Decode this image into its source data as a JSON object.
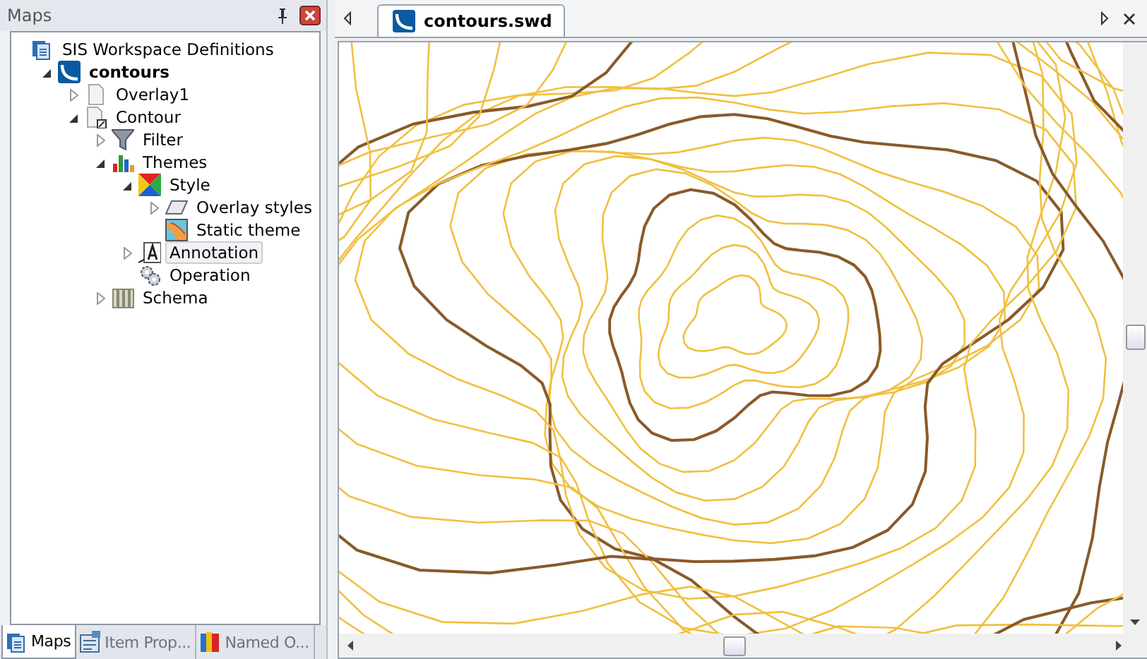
{
  "panel": {
    "title": "Maps"
  },
  "tree": [
    {
      "label": "SIS Workspace Definitions",
      "kind": "workspace",
      "selected": false,
      "children": [
        {
          "label": "contours",
          "kind": "document",
          "bold": true,
          "expanded": true,
          "selected": false,
          "children": [
            {
              "label": "Overlay1",
              "kind": "overlay",
              "expanded": false,
              "selected": false
            },
            {
              "label": "Contour",
              "kind": "contour",
              "expanded": true,
              "selected": false,
              "children": [
                {
                  "label": "Filter",
                  "kind": "filter",
                  "expanded": false,
                  "selected": false
                },
                {
                  "label": "Themes",
                  "kind": "themes",
                  "expanded": true,
                  "selected": false,
                  "children": [
                    {
                      "label": "Style",
                      "kind": "style",
                      "expanded": true,
                      "selected": false,
                      "children": [
                        {
                          "label": "Overlay styles",
                          "kind": "layer",
                          "expanded": false,
                          "selected": false
                        },
                        {
                          "label": "Static theme",
                          "kind": "theme",
                          "selected": false
                        }
                      ]
                    },
                    {
                      "label": "Annotation",
                      "kind": "annotation",
                      "expanded": false,
                      "selected": true
                    },
                    {
                      "label": "Operation",
                      "kind": "operation",
                      "selected": false
                    }
                  ]
                },
                {
                  "label": "Schema",
                  "kind": "schema",
                  "expanded": false,
                  "selected": false
                }
              ]
            }
          ]
        }
      ]
    }
  ],
  "bottom_tabs": [
    {
      "label": "Maps",
      "kind": "workspace",
      "selected": true
    },
    {
      "label": "Item Prop...",
      "kind": "properties",
      "selected": false
    },
    {
      "label": "Named O...",
      "kind": "books",
      "selected": false
    }
  ],
  "document_tabs": [
    {
      "label": "contours.swd",
      "selected": true
    }
  ]
}
